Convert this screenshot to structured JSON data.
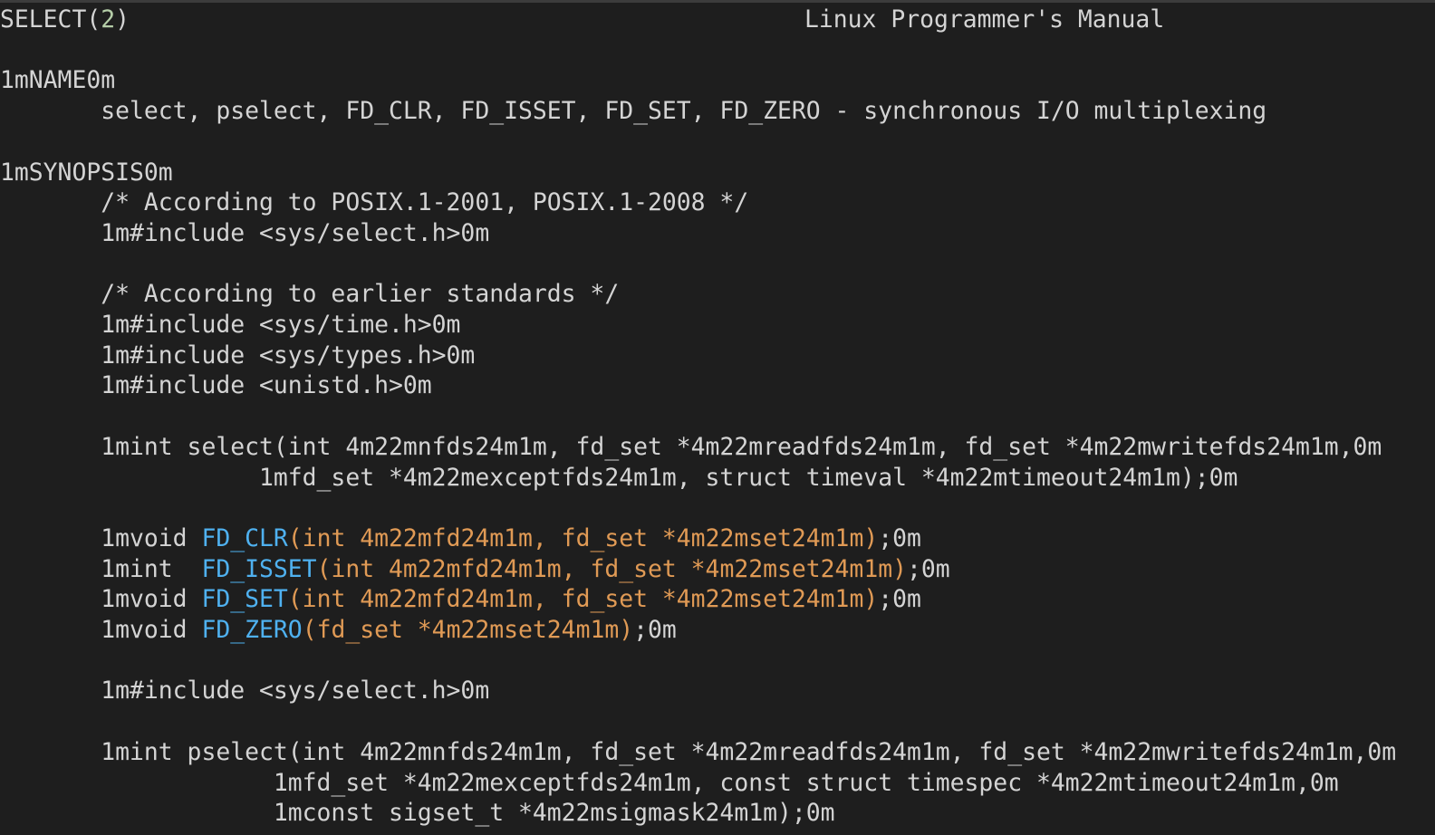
{
  "header": {
    "left_page": "SELECT(",
    "left_section": "2",
    "left_close": ")",
    "center_title": "Linux Programmer's Manual"
  },
  "lines": {
    "l3": "1mNAME0m",
    "l4": "       select, pselect, FD_CLR, FD_ISSET, FD_SET, FD_ZERO - synchronous I/O multiplexing",
    "l6": "1mSYNOPSIS0m",
    "l7": "       /* According to POSIX.1-2001, POSIX.1-2008 */",
    "l8": "       1m#include <sys/select.h>0m",
    "l10": "       /* According to earlier standards */",
    "l11": "       1m#include <sys/time.h>0m",
    "l12": "       1m#include <sys/types.h>0m",
    "l13": "       1m#include <unistd.h>0m",
    "l15": "       1mint select(int 4m22mnfds24m1m, fd_set *4m22mreadfds24m1m, fd_set *4m22mwritefds24m1m,0m",
    "l16": "                  1mfd_set *4m22mexceptfds24m1m, struct timeval *4m22mtimeout24m1m);0m",
    "l18_a": "       1mvoid ",
    "l18_b": "FD_CLR",
    "l18_c": "(int 4m22mfd24m1m, fd_set *4m22mset24m1m)",
    "l18_d": ";0m",
    "l19_a": "       1mint  ",
    "l19_b": "FD_ISSET",
    "l19_c": "(int 4m22mfd24m1m, fd_set *4m22mset24m1m)",
    "l19_d": ";0m",
    "l20_a": "       1mvoid ",
    "l20_b": "FD_SET",
    "l20_c": "(int 4m22mfd24m1m, fd_set *4m22mset24m1m)",
    "l20_d": ";0m",
    "l21_a": "       1mvoid ",
    "l21_b": "FD_ZERO",
    "l21_c": "(fd_set *4m22mset24m1m)",
    "l21_d": ";0m",
    "l23": "       1m#include <sys/select.h>0m",
    "l25": "       1mint pselect(int 4m22mnfds24m1m, fd_set *4m22mreadfds24m1m, fd_set *4m22mwritefds24m1m,0m",
    "l26": "                   1mfd_set *4m22mexceptfds24m1m, const struct timespec *4m22mtimeout24m1m,0m",
    "l27": "                   1mconst sigset_t *4m22msigmask24m1m);0m"
  },
  "colors": {
    "background": "#1e1e1e",
    "text": "#d4d4d4",
    "section_number": "#b5cea8",
    "function_name": "#4fb1f0",
    "argument": "#e09a55"
  }
}
